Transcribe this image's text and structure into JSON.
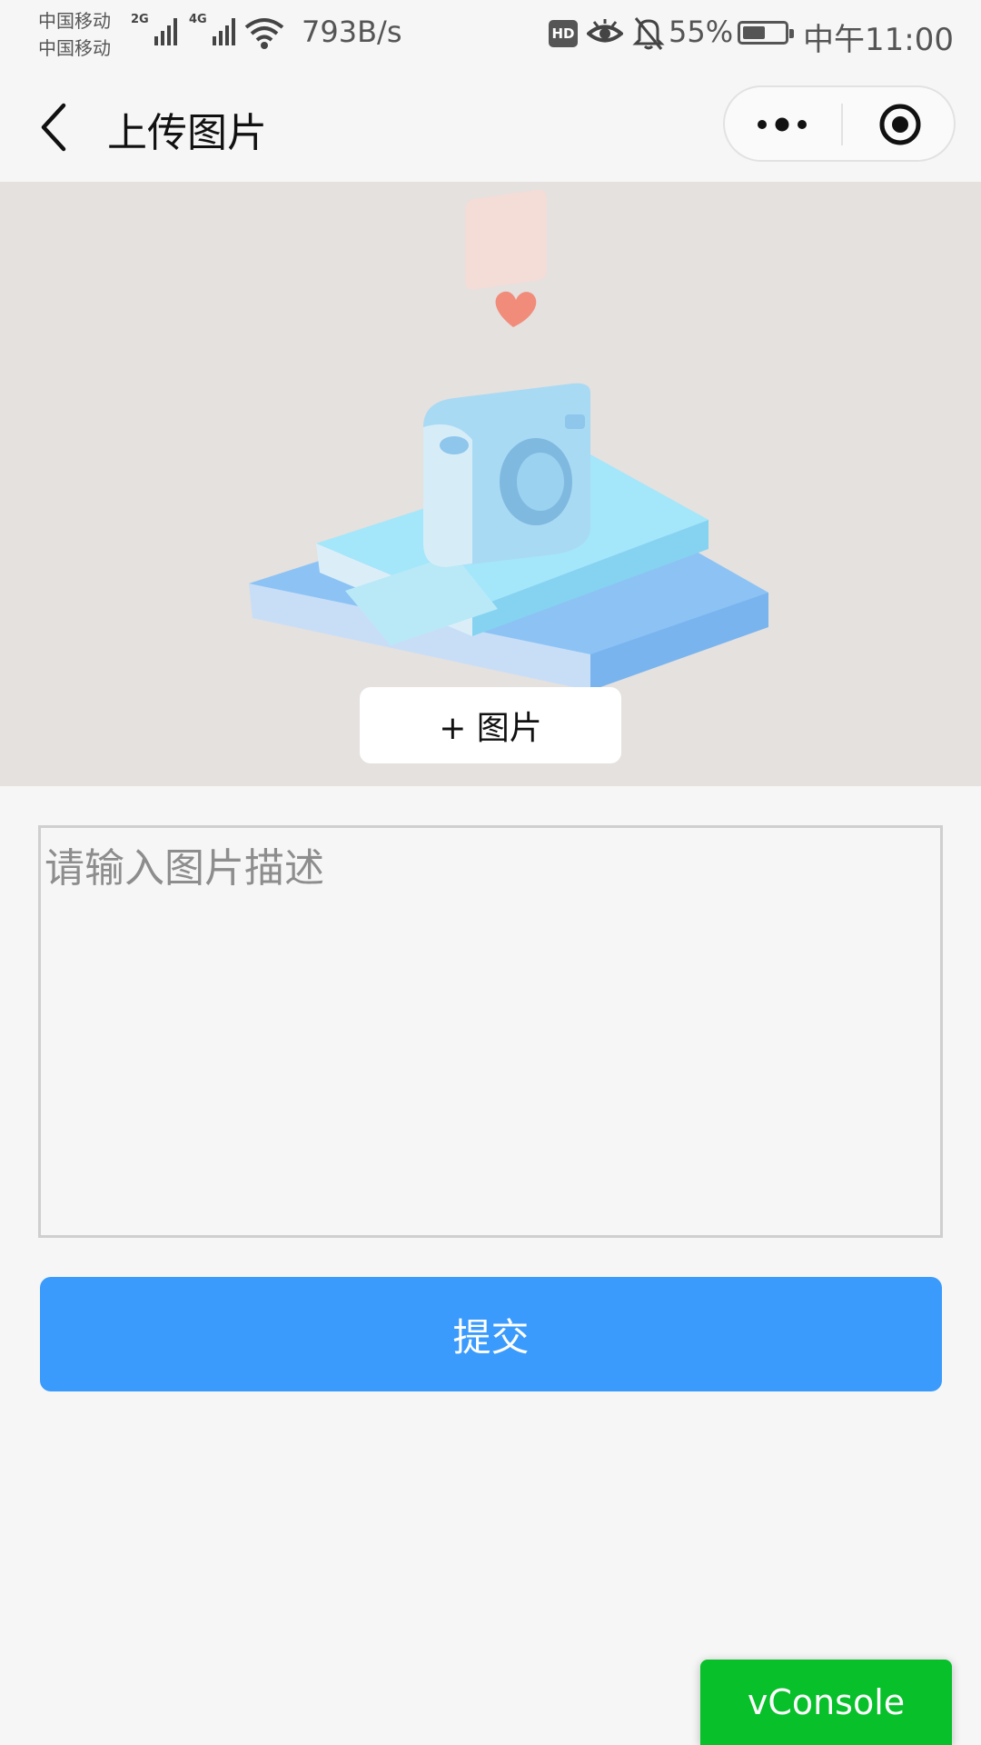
{
  "status_bar": {
    "carrier_1": "中国移动",
    "carrier_2": "中国移动",
    "signal_1": "2G",
    "signal_2": "4G",
    "net_speed": "793B/s",
    "hd": "HD",
    "battery_percent": "55%",
    "battery_level": 0.55,
    "time": "中午11:00"
  },
  "nav": {
    "title": "上传图片"
  },
  "hero": {
    "add_image_label": "+ 图片"
  },
  "form": {
    "description_placeholder": "请输入图片描述",
    "submit_label": "提交"
  },
  "debug": {
    "vconsole_label": "vConsole"
  },
  "colors": {
    "primary": "#3a9bfc",
    "vconsole": "#07c02a",
    "hero_bg": "#e4e1df"
  }
}
